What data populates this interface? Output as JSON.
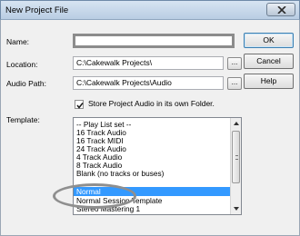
{
  "window": {
    "title": "New Project File"
  },
  "fields": {
    "name_label": "Name:",
    "name_value": "",
    "location_label": "Location:",
    "location_value": "C:\\Cakewalk Projects\\",
    "audio_path_label": "Audio Path:",
    "audio_path_value": "C:\\Cakewalk Projects\\Audio",
    "browse_label": "...",
    "store_checkbox_label": "Store Project Audio in its own Folder.",
    "store_checked": true,
    "template_label": "Template:"
  },
  "buttons": {
    "ok": "OK",
    "cancel": "Cancel",
    "help": "Help"
  },
  "template_list": {
    "items": [
      "-- Play List set --",
      "16 Track Audio",
      "16 Track MIDI",
      "24 Track Audio",
      "4 Track Audio",
      "8 Track Audio",
      "Blank (no tracks or buses)",
      "",
      "Normal",
      "Normal Session Template",
      "Stereo Mastering 1",
      ""
    ],
    "selected": "Normal"
  },
  "icons": {
    "close": "close-icon",
    "check": "checkmark-icon"
  }
}
